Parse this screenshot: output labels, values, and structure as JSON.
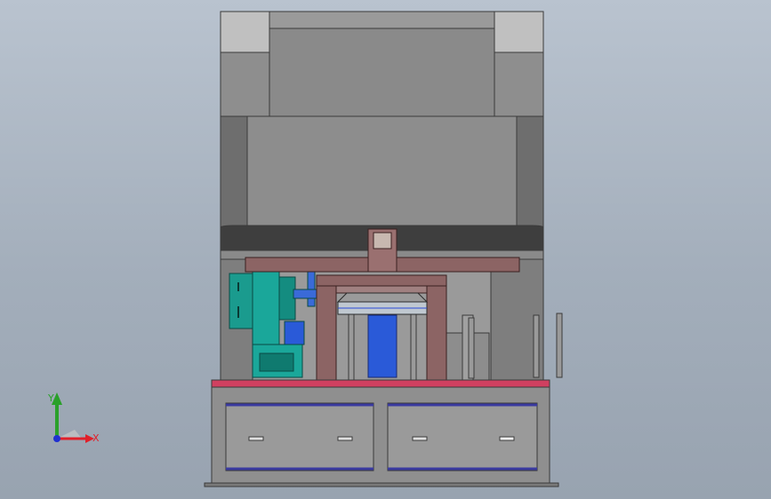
{
  "triad": {
    "x_label": "X",
    "y_label": "Y",
    "x_color": "#e0202a",
    "y_color": "#2aa02a",
    "z_color": "#2030d0"
  },
  "colors": {
    "background": "#a9b3bf",
    "press_body": "#8c8c8c",
    "press_light": "#b4b4b4",
    "frame_brown": "#8c6464",
    "teal_feeder": "#1aa79a",
    "blue_part": "#2a5ad8",
    "accent_red": "#d04060"
  },
  "scene": {
    "name": "press-machine-assembly"
  }
}
